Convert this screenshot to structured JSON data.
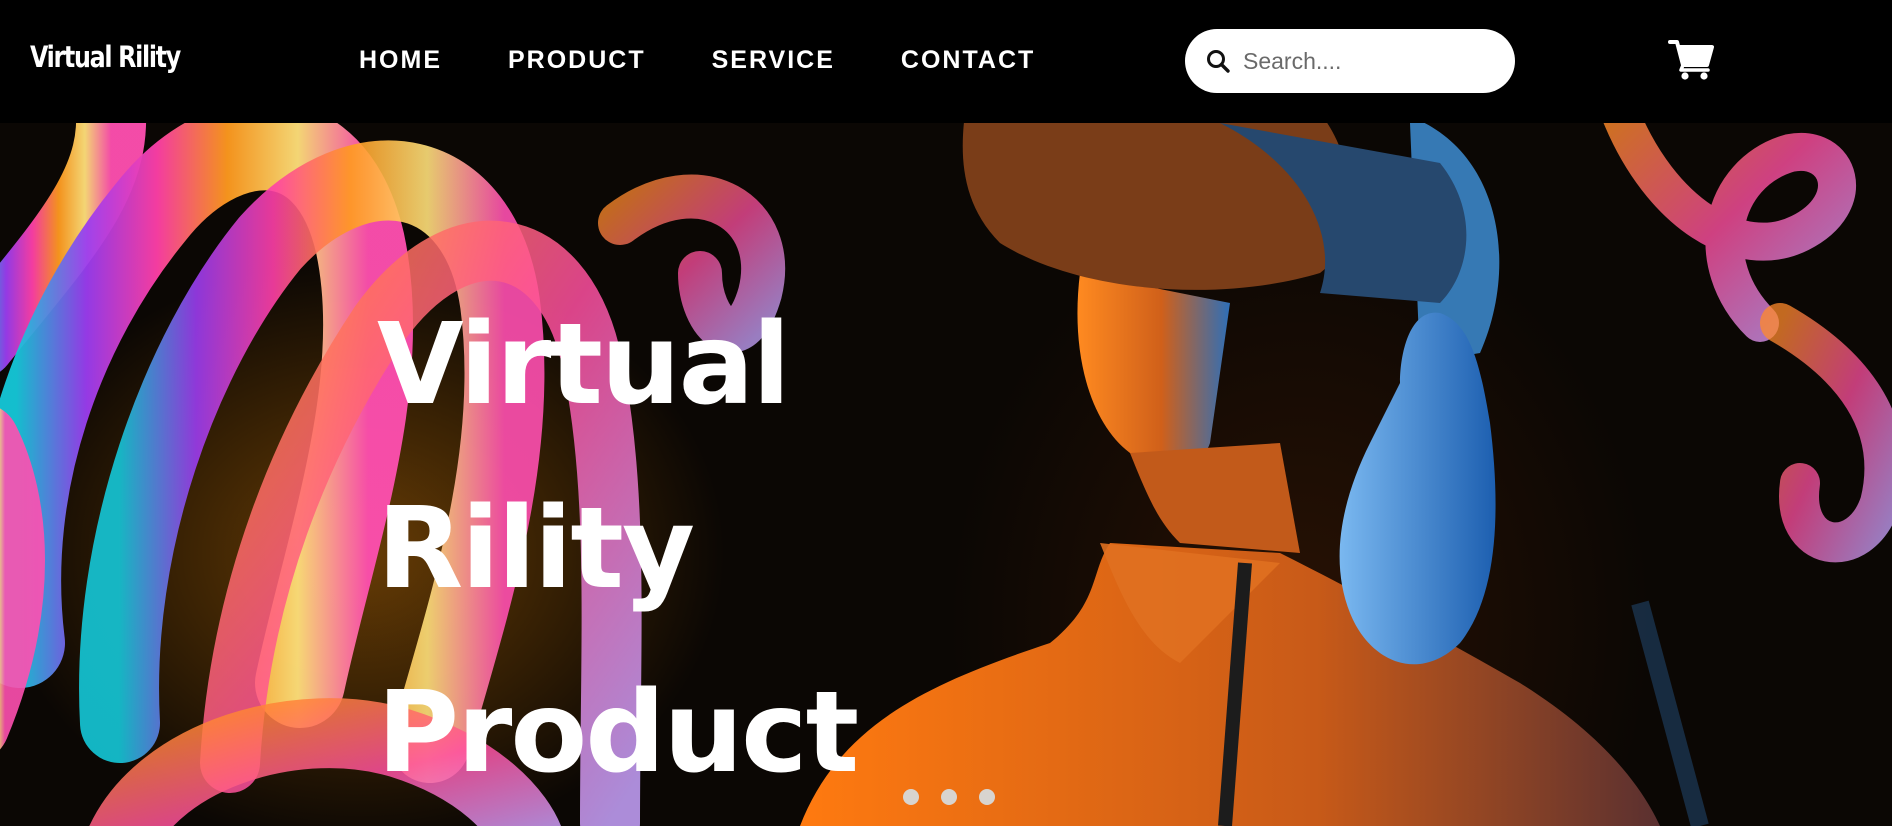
{
  "brand": {
    "logo_text": "Virtual Rility"
  },
  "nav": {
    "items": [
      {
        "label": "HOME"
      },
      {
        "label": "PRODUCT"
      },
      {
        "label": "SERVICE"
      },
      {
        "label": "CONTACT"
      }
    ]
  },
  "search": {
    "placeholder": "Search....",
    "value": ""
  },
  "icons": {
    "search": "search-icon",
    "cart": "cart-icon"
  },
  "hero": {
    "title_lines": [
      "Virtual",
      "Rility",
      "Product"
    ],
    "carousel": {
      "slides": 3
    }
  },
  "colors": {
    "navbar_bg": "#000000",
    "text": "#ffffff",
    "search_bg": "#ffffff",
    "dot": "#d8d4cf"
  }
}
